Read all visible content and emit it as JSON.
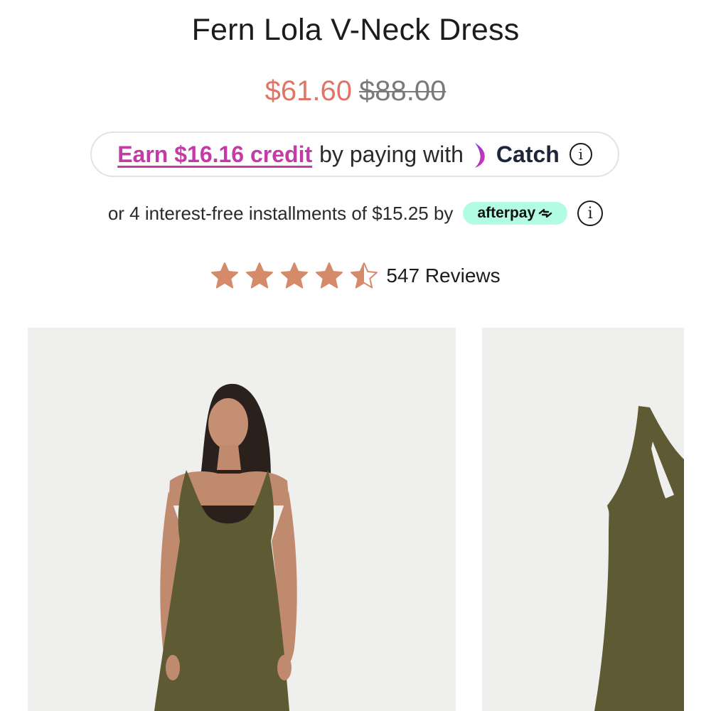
{
  "product": {
    "title": "Fern Lola V-Neck Dress",
    "sale_price": "$61.60",
    "original_price": "$88.00"
  },
  "catch": {
    "earn_text": "Earn $16.16 credit",
    "mid_text": "by paying with",
    "brand": "Catch",
    "info_icon": "ⓘ"
  },
  "afterpay": {
    "text": "or 4 interest-free installments of $15.25 by",
    "brand": "afterpay",
    "info_icon": "i"
  },
  "reviews": {
    "rating": 4.5,
    "max": 5,
    "count_text": "547 Reviews"
  },
  "colors": {
    "sale": "#e07565",
    "catch_accent": "#c43ba8",
    "afterpay_badge": "#b2fce4",
    "star": "#d58a69",
    "dress": "#5d5a34"
  },
  "images": [
    {
      "name": "model-front-photo"
    },
    {
      "name": "dress-flat-photo"
    }
  ]
}
